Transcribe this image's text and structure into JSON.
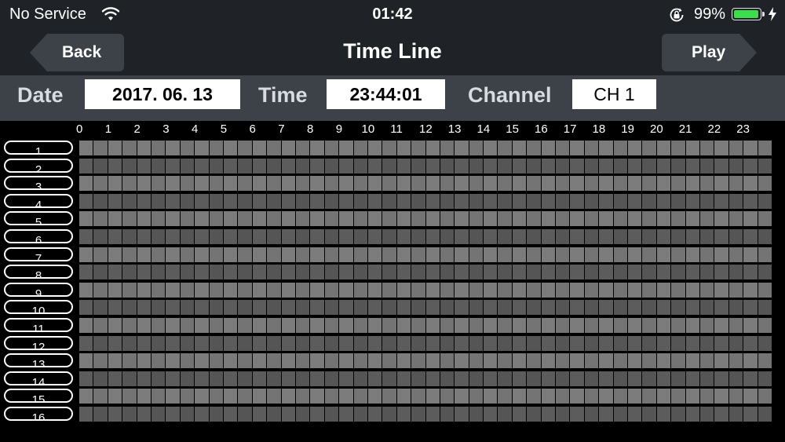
{
  "status": {
    "carrier": "No Service",
    "time": "01:42",
    "battery_percent": "99%",
    "battery_level": 0.99,
    "icons": [
      "wifi-icon",
      "orientation-lock-icon",
      "battery-icon",
      "charging-bolt-icon"
    ]
  },
  "nav": {
    "title": "Time Line",
    "back_label": "Back",
    "play_label": "Play"
  },
  "info": {
    "date_label": "Date",
    "date_value": "2017. 06. 13",
    "time_label": "Time",
    "time_value": "23:44:01",
    "channel_label": "Channel",
    "channel_value": "CH 1"
  },
  "timeline": {
    "hours": [
      "0",
      "1",
      "2",
      "3",
      "4",
      "5",
      "6",
      "7",
      "8",
      "9",
      "10",
      "11",
      "12",
      "13",
      "14",
      "15",
      "16",
      "17",
      "18",
      "19",
      "20",
      "21",
      "22",
      "23"
    ],
    "channels": [
      "1",
      "2",
      "3",
      "4",
      "5",
      "6",
      "7",
      "8",
      "9",
      "10",
      "11",
      "12",
      "13",
      "14",
      "15",
      "16"
    ],
    "segments_per_hour": 2
  },
  "colors": {
    "bar_background": "#1f2328",
    "info_background": "#3d4248",
    "battery_fill": "#3ddc4a"
  }
}
